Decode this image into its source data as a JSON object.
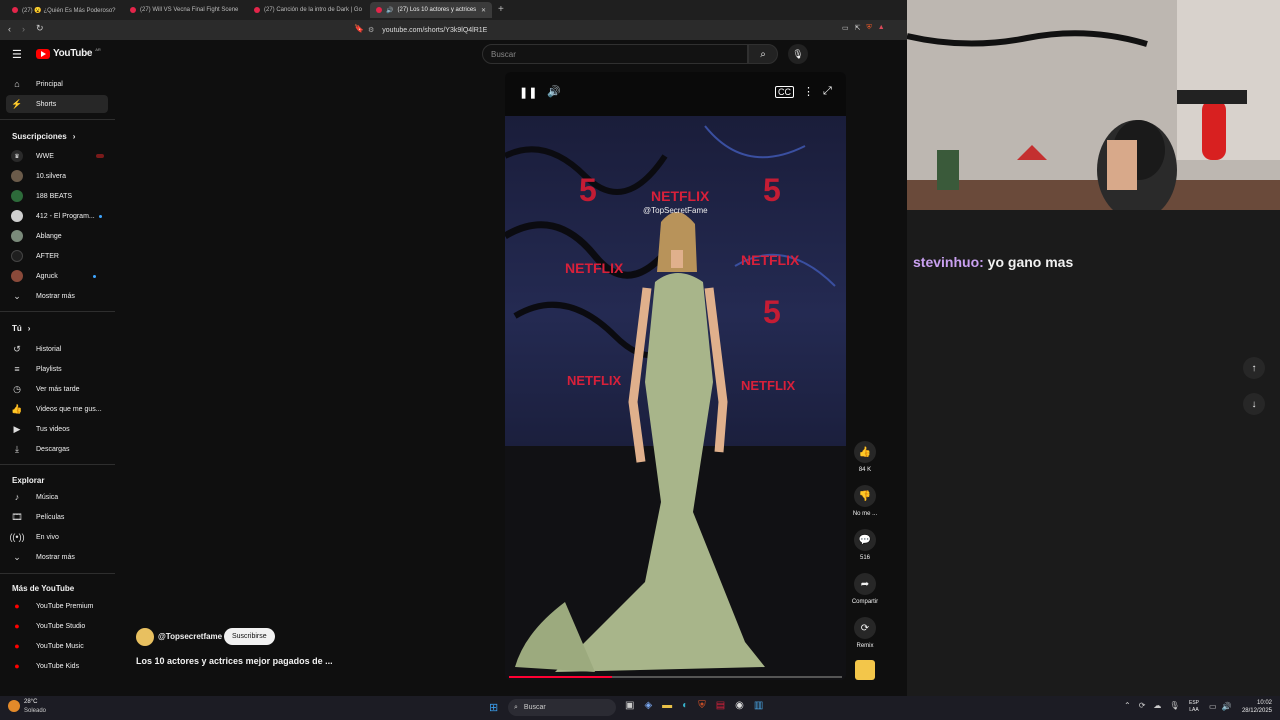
{
  "browser": {
    "tabs": [
      {
        "label": "(27) 😮 ¿Quién Es Más Poderoso?"
      },
      {
        "label": "(27) Will VS Vecna Final Fight Scene"
      },
      {
        "label": "(27) Canción de la intro de Dark | Go"
      },
      {
        "label": "(27) Los 10 actores y actrices"
      }
    ],
    "url": "youtube.com/shorts/Y3k9lQ4lR1E"
  },
  "youtube": {
    "logo": "YouTube",
    "logo_region": "AR",
    "search_placeholder": "Buscar",
    "nav": [
      {
        "label": "Principal",
        "icon": "home-icon"
      },
      {
        "label": "Shorts",
        "icon": "shorts-icon"
      }
    ],
    "subscriptions_title": "Suscripciones",
    "subscriptions": [
      {
        "label": "WWE",
        "color": "#2a2a2a",
        "badge": "live"
      },
      {
        "label": "10.silvera",
        "color": "#6b5b4a"
      },
      {
        "label": "188 BEATS",
        "color": "#2d6b3a"
      },
      {
        "label": "412 - El Program...",
        "color": "#cfcfcf",
        "badge": "dot"
      },
      {
        "label": "Ablange",
        "color": "#7a8a7a"
      },
      {
        "label": "AFTER",
        "color": "#1f1f1f"
      },
      {
        "label": "Agruck",
        "color": "#8a4a3a",
        "badge": "dot"
      }
    ],
    "show_more": "Mostrar más",
    "you_title": "Tú",
    "you_items": [
      {
        "label": "Historial",
        "icon": "history-icon"
      },
      {
        "label": "Playlists",
        "icon": "playlist-icon"
      },
      {
        "label": "Ver más tarde",
        "icon": "clock-icon"
      },
      {
        "label": "Videos que me gus...",
        "icon": "thumbs-up-icon"
      },
      {
        "label": "Tus videos",
        "icon": "video-icon"
      },
      {
        "label": "Descargas",
        "icon": "download-icon"
      }
    ],
    "explore_title": "Explorar",
    "explore_items": [
      {
        "label": "Música",
        "icon": "music-icon"
      },
      {
        "label": "Películas",
        "icon": "film-icon"
      },
      {
        "label": "En vivo",
        "icon": "live-icon"
      },
      {
        "label": "Mostrar más",
        "icon": "chevron-down-icon"
      }
    ],
    "more_title": "Más de YouTube",
    "more_items": [
      {
        "label": "YouTube Premium"
      },
      {
        "label": "YouTube Studio"
      },
      {
        "label": "YouTube Music"
      },
      {
        "label": "YouTube Kids"
      }
    ],
    "short": {
      "channel": "@Topsecretfame",
      "subscribe": "Suscribirse",
      "title": "Los 10 actores y actrices mejor pagados de ...",
      "watermark": "@TopSecretFame",
      "actions": [
        {
          "label": "84 K",
          "icon": "thumbs-up-icon"
        },
        {
          "label": "No me ...",
          "icon": "thumbs-down-icon"
        },
        {
          "label": "516",
          "icon": "comment-icon"
        },
        {
          "label": "Compartir",
          "icon": "share-icon"
        },
        {
          "label": "Remix",
          "icon": "remix-icon"
        }
      ],
      "backdrop_text": "NETFLIX",
      "backdrop_number": "5"
    }
  },
  "chat": {
    "user": "stevinhuo:",
    "message": "yo gano mas",
    "user_color": "#c9a0f0"
  },
  "taskbar": {
    "weather_temp": "28°C",
    "weather_desc": "Soleado",
    "search": "Buscar",
    "lang_top": "ESP",
    "lang_bottom": "LAA",
    "time": "10:02",
    "date": "28/12/2025"
  }
}
